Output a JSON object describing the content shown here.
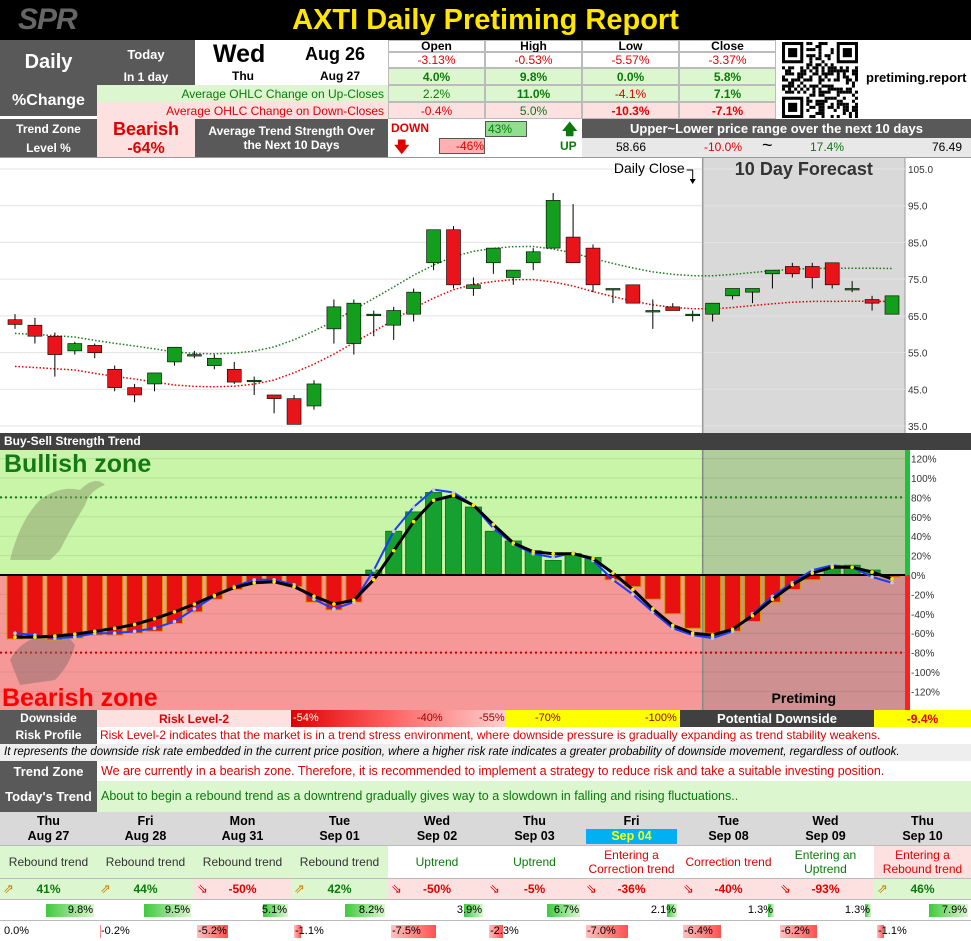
{
  "title": "AXTI Daily Pretiming Report",
  "logo": "SPR",
  "site": "pretiming.report",
  "header": {
    "daily": "Daily",
    "pct_change": "%Change",
    "today": "Today",
    "in1day": "In 1 day",
    "today_day": "Wed",
    "today_date": "Aug 26",
    "next_day": "Thu",
    "next_date": "Aug 27",
    "cols": [
      "Open",
      "High",
      "Low",
      "Close"
    ],
    "today_vals": [
      "-3.13%",
      "-0.53%",
      "-5.57%",
      "-3.37%"
    ],
    "next_vals": [
      "4.0%",
      "9.8%",
      "0.0%",
      "5.8%"
    ],
    "up_label": "Average OHLC Change on Up-Closes",
    "up_vals": [
      "2.2%",
      "11.0%",
      "-4.1%",
      "7.1%"
    ],
    "down_label": "Average OHLC Change on Down-Closes",
    "down_vals": [
      "-0.4%",
      "5.0%",
      "-10.3%",
      "-7.1%"
    ]
  },
  "trend": {
    "zone_label": "Trend Zone",
    "level_label": "Level %",
    "zone": "Bearish",
    "level": "-64%",
    "strength_label": "Average Trend Strength Over the Next 10 Days",
    "down": "DOWN",
    "down_val": "-46%",
    "up": "UP",
    "up_val": "43%",
    "down_fill": 0.46,
    "up_fill": 0.43,
    "range_label": "Upper~Lower price range over the next 10 days",
    "range": [
      "58.66",
      "-10.0%",
      "~",
      "17.4%",
      "76.49"
    ]
  },
  "price_chart": {
    "daily_close_label": "Daily Close",
    "forecast_label": "10 Day Forecast",
    "yticks": [
      "105.0",
      "95.0",
      "85.0",
      "75.0",
      "65.0",
      "55.0",
      "45.0",
      "35.0"
    ]
  },
  "chart_data": [
    {
      "type": "candlestick",
      "ylim": [
        35,
        105
      ],
      "candles": [
        [
          64.5,
          66,
          62,
          63.2
        ],
        [
          63,
          65,
          58,
          60
        ],
        [
          60,
          61,
          49,
          55
        ],
        [
          56,
          58.5,
          55,
          58
        ],
        [
          57.5,
          58,
          54,
          55.5
        ],
        [
          51,
          52,
          45,
          46
        ],
        [
          46,
          47,
          42,
          44
        ],
        [
          47,
          48.5,
          45,
          50
        ],
        [
          53,
          57,
          52,
          57
        ],
        [
          55,
          56,
          54,
          55
        ],
        [
          52,
          55,
          51,
          54
        ],
        [
          51,
          53,
          47,
          47.5
        ],
        [
          48,
          49,
          44,
          48
        ],
        [
          44,
          44,
          39,
          43
        ],
        [
          43,
          44,
          36,
          36
        ],
        [
          41,
          48,
          40,
          47
        ],
        [
          62,
          70,
          58,
          68
        ],
        [
          58,
          70,
          55,
          69
        ],
        [
          66,
          67,
          60,
          66
        ],
        [
          63,
          68,
          59,
          67
        ],
        [
          66,
          73,
          64,
          72
        ],
        [
          80,
          89,
          78,
          89
        ],
        [
          89,
          90,
          73,
          74
        ],
        [
          73,
          76,
          71,
          74
        ],
        [
          80,
          84,
          77,
          84
        ],
        [
          76,
          78,
          74,
          78
        ],
        [
          80,
          84,
          78,
          83
        ],
        [
          84,
          99,
          84,
          97
        ],
        [
          87,
          96,
          81,
          80
        ],
        [
          84,
          85,
          72,
          74
        ],
        [
          73,
          73,
          69,
          73
        ],
        [
          74,
          74,
          70,
          69
        ],
        [
          67,
          70,
          62,
          67
        ],
        [
          68,
          69,
          67,
          67
        ],
        [
          66,
          67,
          64,
          66
        ],
        [
          66,
          68,
          64,
          69
        ],
        [
          71,
          73,
          70,
          73
        ],
        [
          72,
          73,
          69,
          73
        ],
        [
          77,
          78,
          73,
          78
        ],
        [
          79,
          80,
          76,
          77
        ],
        [
          79,
          80,
          73,
          76
        ],
        [
          80,
          80,
          73,
          74
        ],
        [
          73,
          75,
          72,
          73
        ],
        [
          70,
          71,
          67,
          69
        ],
        [
          66,
          71,
          66,
          71
        ]
      ],
      "last_actual_index": 34
    },
    {
      "type": "bar",
      "title": "Buy-Sell Strength Trend",
      "ylim": [
        -130,
        130
      ],
      "yticks": [
        "120%",
        "100%",
        "80%",
        "60%",
        "40%",
        "20%",
        "0%",
        "-20%",
        "-40%",
        "-60%",
        "-80%",
        "-100%",
        "-120%"
      ],
      "values": [
        -66,
        -65,
        -67,
        -65,
        -62,
        -62,
        -60,
        -58,
        -50,
        -38,
        -25,
        -15,
        -9,
        -8,
        -12,
        -28,
        -36,
        -28,
        5,
        45,
        65,
        85,
        80,
        70,
        45,
        35,
        25,
        15,
        22,
        18,
        -5,
        -12,
        -25,
        -40,
        -55,
        -60,
        -58,
        -48,
        -28,
        -15,
        -5,
        8,
        10,
        5,
        -2
      ],
      "forecast_line": [
        -60,
        -62,
        -65,
        -64,
        -60,
        -60,
        -58,
        -55,
        -48,
        -35,
        -22,
        -12,
        -5,
        -5,
        -10,
        -25,
        -35,
        -28,
        5,
        45,
        70,
        88,
        85,
        72,
        48,
        32,
        22,
        18,
        23,
        15,
        -5,
        -20,
        -38,
        -55,
        -62,
        -65,
        -58,
        -40,
        -22,
        -8,
        5,
        10,
        8,
        -2,
        -8
      ],
      "smooth_line": [
        -64,
        -64,
        -63,
        -61,
        -58,
        -55,
        -51,
        -45,
        -38,
        -30,
        -21,
        -13,
        -8,
        -7,
        -12,
        -22,
        -30,
        -26,
        -5,
        25,
        55,
        77,
        82,
        72,
        52,
        33,
        24,
        22,
        22,
        17,
        2,
        -15,
        -35,
        -52,
        -60,
        -62,
        -56,
        -42,
        -25,
        -10,
        2,
        8,
        8,
        3,
        -4
      ],
      "upper_threshold": 80,
      "lower_threshold": -80,
      "zone_labels": [
        "Bullish zone",
        "Bearish zone"
      ],
      "last_actual_index": 34,
      "forecast_label": "Pretiming"
    }
  ],
  "risk": {
    "label": "Downside Risk Profile",
    "level": "Risk Level-2",
    "scale": [
      "-54%",
      "-40%",
      "-55%",
      "-70%",
      "-100%"
    ],
    "potential_label": "Potential Downside",
    "potential": "-9.4%",
    "desc": "Risk Level-2 indicates that the market is in a trend stress environment, where downside pressure is gradually expanding as trend stability weakens.",
    "note": "It represents the downside risk rate embedded in the current price position, where a higher risk rate indicates a greater probability of downside movement, regardless of outlook."
  },
  "zone_text": {
    "label": "Trend Zone",
    "text": "We are currently in a bearish zone. Therefore, it is recommended to implement a strategy to reduce risk and take a suitable investing position."
  },
  "today_trend": {
    "label": "Today's Trend",
    "text": "About to begin a rebound trend as a downtrend gradually gives way to a slowdown in falling and rising fluctuations.."
  },
  "forecast": [
    {
      "day": "Thu",
      "date": "Aug 27",
      "trend": "Rebound trend",
      "pct": "41%",
      "dir": "up",
      "hi": "9.8%",
      "lo": "0.0%",
      "hi_v": 9.8,
      "lo_v": 0.0,
      "hl": false
    },
    {
      "day": "Fri",
      "date": "Aug 28",
      "trend": "Rebound trend",
      "pct": "44%",
      "dir": "up",
      "hi": "9.5%",
      "lo": "-0.2%",
      "hi_v": 9.5,
      "lo_v": -0.2,
      "hl": false
    },
    {
      "day": "Mon",
      "date": "Aug 31",
      "trend": "Rebound trend",
      "pct": "-50%",
      "dir": "down",
      "hi": "5.1%",
      "lo": "-5.2%",
      "hi_v": 5.1,
      "lo_v": -5.2,
      "hl": false
    },
    {
      "day": "Tue",
      "date": "Sep 01",
      "trend": "Rebound trend",
      "pct": "42%",
      "dir": "up",
      "hi": "8.2%",
      "lo": "-1.1%",
      "hi_v": 8.2,
      "lo_v": -1.1,
      "hl": false
    },
    {
      "day": "Wed",
      "date": "Sep 02",
      "trend": "Uptrend",
      "pct": "-50%",
      "dir": "down",
      "hi": "3.9%",
      "lo": "-7.5%",
      "hi_v": 3.9,
      "lo_v": -7.5,
      "hl": false
    },
    {
      "day": "Thu",
      "date": "Sep 03",
      "trend": "Uptrend",
      "pct": "-5%",
      "dir": "down",
      "hi": "6.7%",
      "lo": "-2.3%",
      "hi_v": 6.7,
      "lo_v": -2.3,
      "hl": false
    },
    {
      "day": "Fri",
      "date": "Sep 04",
      "trend": "Entering a Correction trend",
      "pct": "-36%",
      "dir": "down",
      "hi": "2.1%",
      "lo": "-7.0%",
      "hi_v": 2.1,
      "lo_v": -7.0,
      "hl": true
    },
    {
      "day": "Tue",
      "date": "Sep 08",
      "trend": "Correction trend",
      "pct": "-40%",
      "dir": "down",
      "hi": "1.3%",
      "lo": "-6.4%",
      "hi_v": 1.3,
      "lo_v": -6.4,
      "hl": false
    },
    {
      "day": "Wed",
      "date": "Sep 09",
      "trend": "Entering an Uptrend",
      "pct": "-93%",
      "dir": "down",
      "hi": "1.3%",
      "lo": "-6.2%",
      "hi_v": 1.3,
      "lo_v": -6.2,
      "hl": false
    },
    {
      "day": "Thu",
      "date": "Sep 10",
      "trend": "Entering a Rebound trend",
      "pct": "46%",
      "dir": "up",
      "hi": "7.9%",
      "lo": "-1.1%",
      "hi_v": 7.9,
      "lo_v": -1.1,
      "hl": false
    }
  ]
}
